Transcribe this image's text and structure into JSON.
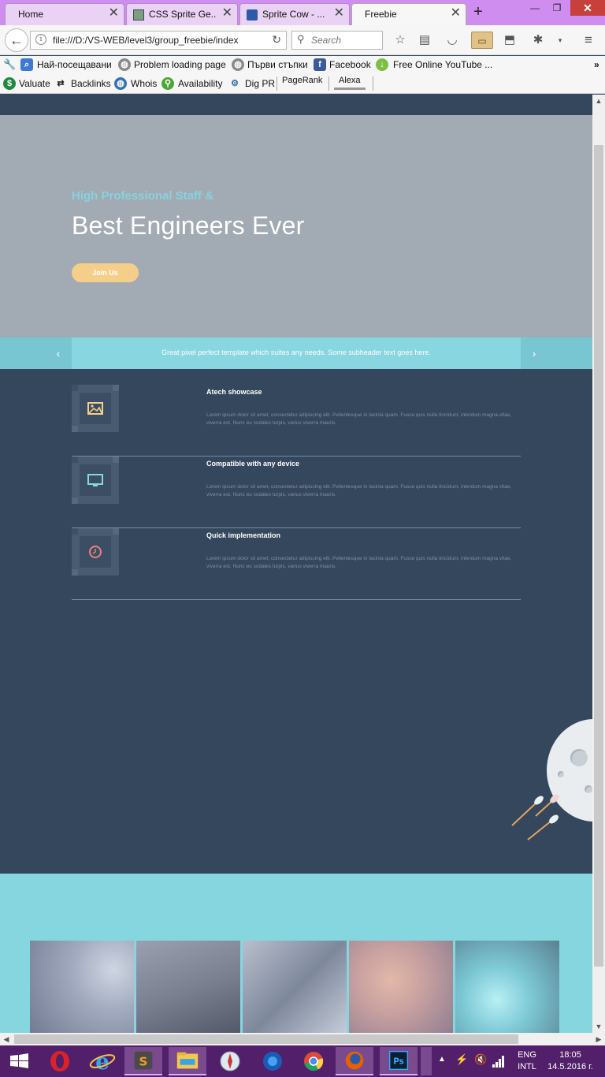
{
  "browser": {
    "tabs": [
      {
        "title": "Home",
        "active": false
      },
      {
        "title": "CSS Sprite Ge...",
        "active": false
      },
      {
        "title": "Sprite Cow - ...",
        "active": false
      },
      {
        "title": "Freebie",
        "active": true
      }
    ],
    "new_tab_label": "+",
    "url": "file:///D:/VS-WEB/level3/group_freebie/index",
    "search_placeholder": "Search"
  },
  "bookmarks": {
    "row1": [
      "Най-посещавани",
      "Problem loading page",
      "Първи стъпки",
      "Facebook",
      "Free Online YouTube ..."
    ],
    "row1_more": "»",
    "row2": [
      "Valuate",
      "Backlinks",
      "Whois",
      "Availability",
      "Dig PR",
      "PageRank",
      "Alexa"
    ]
  },
  "hero": {
    "subtitle": "High Professional Staff &",
    "title": "Best Engineers Ever",
    "button": "Join Us"
  },
  "slider": {
    "text": "Great pixel perfect template which suites any needs. Some subheader text goes here.",
    "prev_icon": "chevron-left-icon",
    "next_icon": "chevron-right-icon"
  },
  "features": [
    {
      "title": "Atech showcase",
      "icon": "image-icon",
      "text": "Lorem ipsum dolor sit amet, consectetur adipiscing elit. Pellentesque in lacinia quam. Fusce quis nulla tincidunt, interdum magna vitae, viverra est. Nunc eu sodales turpis, varius viverra mauris."
    },
    {
      "title": "Compatible with any device",
      "icon": "monitor-icon",
      "text": "Lorem ipsum dolor sit amet, consectetur adipiscing elit. Pellentesque in lacinia quam. Fusce quis nulla tincidunt, interdum magna vitae, viverra est. Nunc eu sodales turpis, varius viverra mauris."
    },
    {
      "title": "Quick implementation",
      "icon": "clock-icon",
      "text": "Lorem ipsum dolor sit amet, consectetur adipiscing elit. Pellentesque in lacinia quam. Fusce quis nulla tincidunt, interdum magna vitae, viverra est. Nunc eu sodales turpis, varius viverra mauris."
    }
  ],
  "colors": {
    "page_bg": "#34475c",
    "hero_bg": "#a2aab3",
    "accent_cyan": "#88d6e0",
    "accent_yellow": "#f5cf8a",
    "taskbar": "#52206a"
  },
  "taskbar": {
    "lang_top": "ENG",
    "lang_bottom": "INTL",
    "time": "18:05",
    "date": "14.5.2016 г."
  }
}
